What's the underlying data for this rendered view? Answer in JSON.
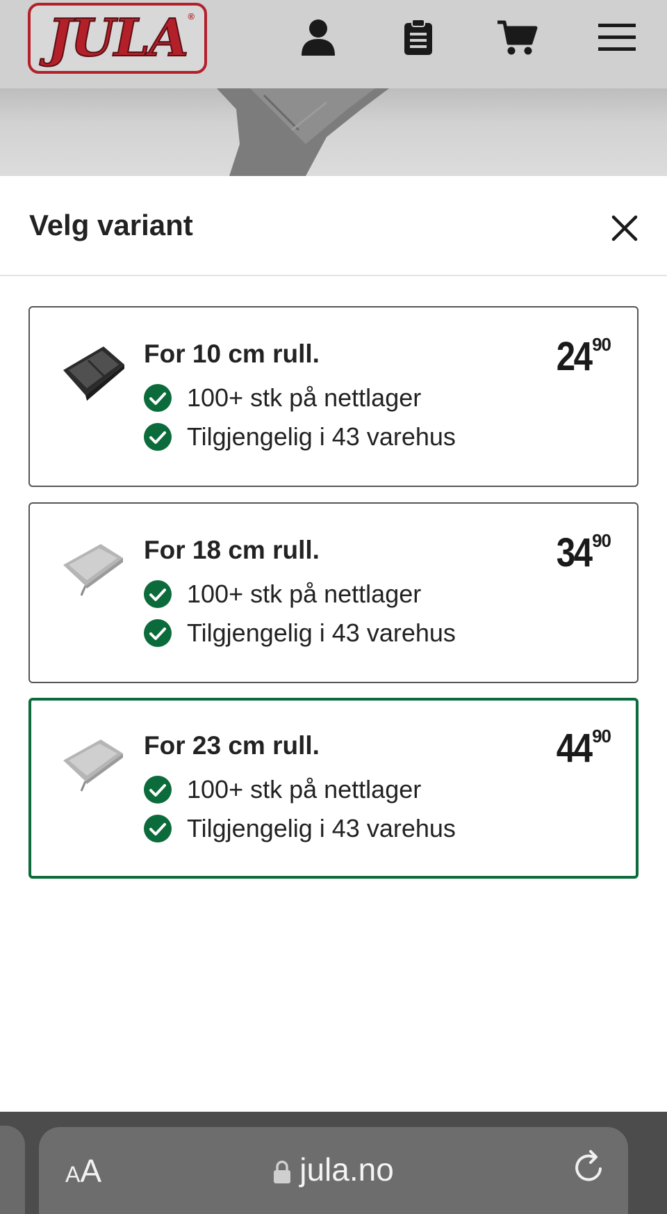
{
  "header": {
    "logo_text": "JULA",
    "logo_reg": "®",
    "icons": [
      "user-icon",
      "clipboard-icon",
      "cart-icon",
      "menu-icon"
    ]
  },
  "sheet": {
    "title": "Velg variant",
    "close_icon": "close-icon"
  },
  "variants": [
    {
      "name": "For 10 cm rull.",
      "price_int": "24",
      "price_dec": "90",
      "stock_online": "100+ stk på nettlager",
      "stock_stores": "Tilgjengelig i 43 varehus",
      "selected": false,
      "thumb": "dark-paint-tray"
    },
    {
      "name": "For 18 cm rull.",
      "price_int": "34",
      "price_dec": "90",
      "stock_online": "100+ stk på nettlager",
      "stock_stores": "Tilgjengelig i 43 varehus",
      "selected": false,
      "thumb": "grey-paint-tray"
    },
    {
      "name": "For 23 cm rull.",
      "price_int": "44",
      "price_dec": "90",
      "stock_online": "100+ stk på nettlager",
      "stock_stores": "Tilgjengelig i 43 varehus",
      "selected": true,
      "thumb": "grey-paint-tray"
    }
  ],
  "browser": {
    "text_size_small": "A",
    "text_size_large": "A",
    "url": "jula.no"
  },
  "colors": {
    "brand_red": "#b3202a",
    "check_green": "#0b6b3a",
    "selected_border": "#0b6b3a"
  }
}
